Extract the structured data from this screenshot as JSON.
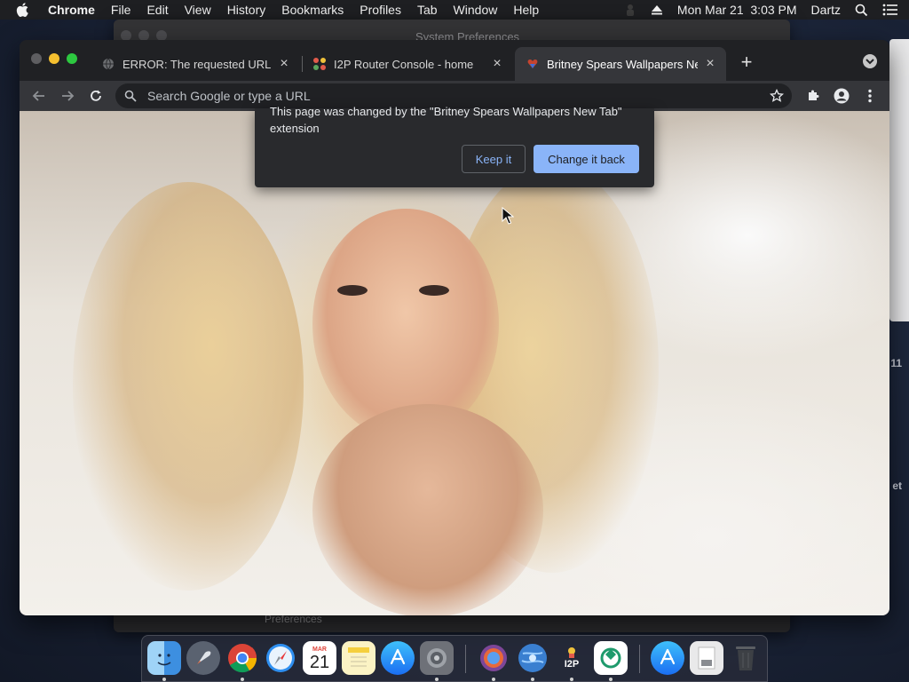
{
  "menubar": {
    "app_name": "Chrome",
    "menus": [
      "File",
      "Edit",
      "View",
      "History",
      "Bookmarks",
      "Profiles",
      "Tab",
      "Window",
      "Help"
    ],
    "datetime": "Mon Mar 21  3:03 PM",
    "user": "Dartz"
  },
  "background_window": {
    "title": "System Preferences",
    "footer_text": "Preferences",
    "side_text_1": "11",
    "side_text_2": "et"
  },
  "chrome": {
    "tabs": [
      {
        "label": "ERROR: The requested URL co",
        "icon": "globe-icon",
        "active": false
      },
      {
        "label": "I2P Router Console - home",
        "icon": "i2p-favicon",
        "active": false
      },
      {
        "label": "Britney Spears Wallpapers New",
        "icon": "extension-favicon",
        "active": true
      }
    ],
    "omnibox": {
      "placeholder": "Search Google or type a URL",
      "value": ""
    }
  },
  "extension_bubble": {
    "message": "This page was changed by the \"Britney Spears Wallpapers New Tab\" extension",
    "keep_label": "Keep it",
    "change_label": "Change it back"
  },
  "dock": {
    "calendar_month": "MAR",
    "calendar_day": "21",
    "i2p_label": "I2P",
    "apps": [
      "Finder",
      "Launchpad",
      "Chrome",
      "Safari",
      "Calendar",
      "Notes",
      "App Store",
      "System Preferences",
      "Tor Browser",
      "Network Utility",
      "I2P",
      "Syncthing",
      "App Store",
      "Preview",
      "Trash"
    ]
  },
  "colors": {
    "accent": "#8ab4f8",
    "chrome_frame": "#202124",
    "toolbar": "#35363a"
  }
}
